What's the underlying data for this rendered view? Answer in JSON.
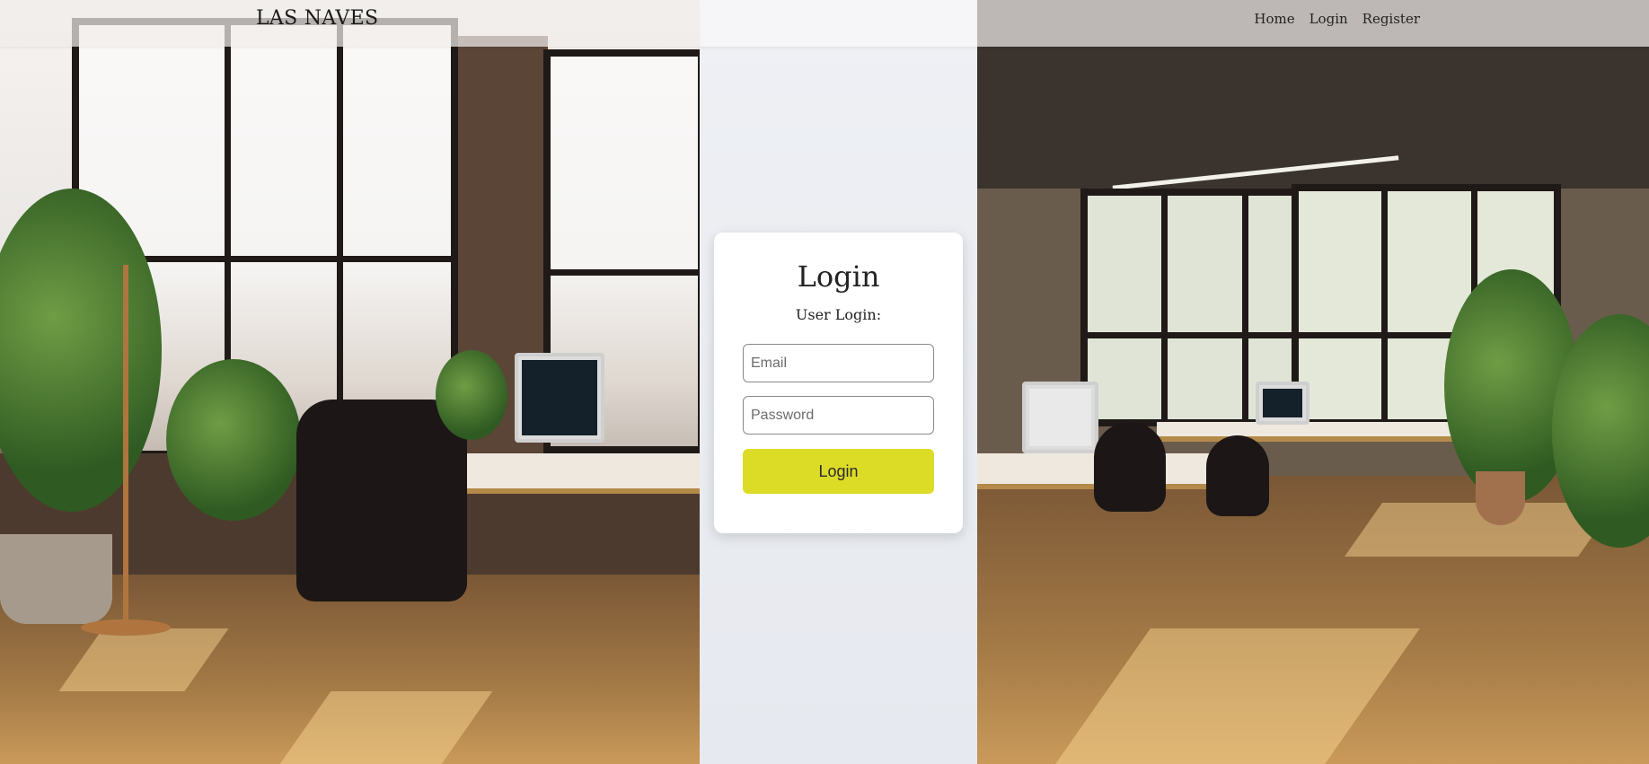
{
  "header": {
    "brand": "LAS NAVES",
    "nav": [
      {
        "label": "Home"
      },
      {
        "label": "Login"
      },
      {
        "label": "Register"
      }
    ]
  },
  "login_card": {
    "title": "Login",
    "subtitle": "User Login:",
    "email_placeholder": "Email",
    "password_placeholder": "Password",
    "submit_label": "Login",
    "accent_color": "#dcdc27"
  }
}
